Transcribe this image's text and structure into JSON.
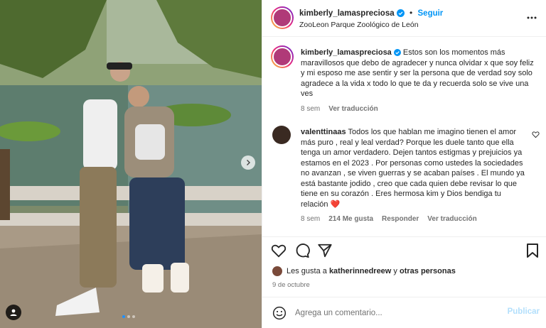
{
  "post": {
    "author": "kimberly_lamaspreciosa",
    "follow_label": "Seguir",
    "separator": "•",
    "location": "ZooLeon Parque Zoológico de León",
    "caption_author": "kimberly_lamaspreciosa",
    "caption": "Estos son los momentos más maravillosos que debo de agradecer y nunca olvidar x que soy feliz y mi esposo me ase sentir y ser la persona que de verdad soy solo agradece a la vida x todo lo que te da y recuerda solo se vive una ves",
    "caption_time": "8 sem",
    "see_translation": "Ver traducción"
  },
  "comment": {
    "author": "valenttinaas",
    "text": "Todos los que hablan me imagino tienen el amor más puro , real y leal verdad? Porque les duele tanto que ella tenga un amor verdadero. Dejen tantos estigmas y prejuicios ya estamos en el 2023 . Por personas como ustedes la sociedades no avanzan , se viven guerras y se acaban países . El mundo ya está bastante jodido , creo que cada quien debe revisar lo que tiene en su corazón . Eres hermosa kim y Dios bendiga tu relación",
    "emoji": "❤️",
    "time": "8 sem",
    "likes": "214 Me gusta",
    "reply": "Responder",
    "see_translation": "Ver traducción"
  },
  "likes_line": {
    "prefix": "Les gusta a",
    "user": "katherinnedreew",
    "connector": "y",
    "others": "otras personas"
  },
  "date": "9 de octubre",
  "add_comment": {
    "placeholder": "Agrega un comentario...",
    "publish_label": "Publicar"
  },
  "carousel": {
    "slides": 3,
    "active": 1
  },
  "icons": [
    "verified-icon",
    "more-icon",
    "heart-icon",
    "comment-icon",
    "share-icon",
    "bookmark-icon",
    "emoji-icon",
    "user-tag-icon",
    "chevron-right-icon"
  ],
  "colors": {
    "accent": "#0095f6",
    "verified": "#0095f6",
    "text": "#262626",
    "muted": "#737373",
    "publish_disabled": "#b2dffc"
  }
}
